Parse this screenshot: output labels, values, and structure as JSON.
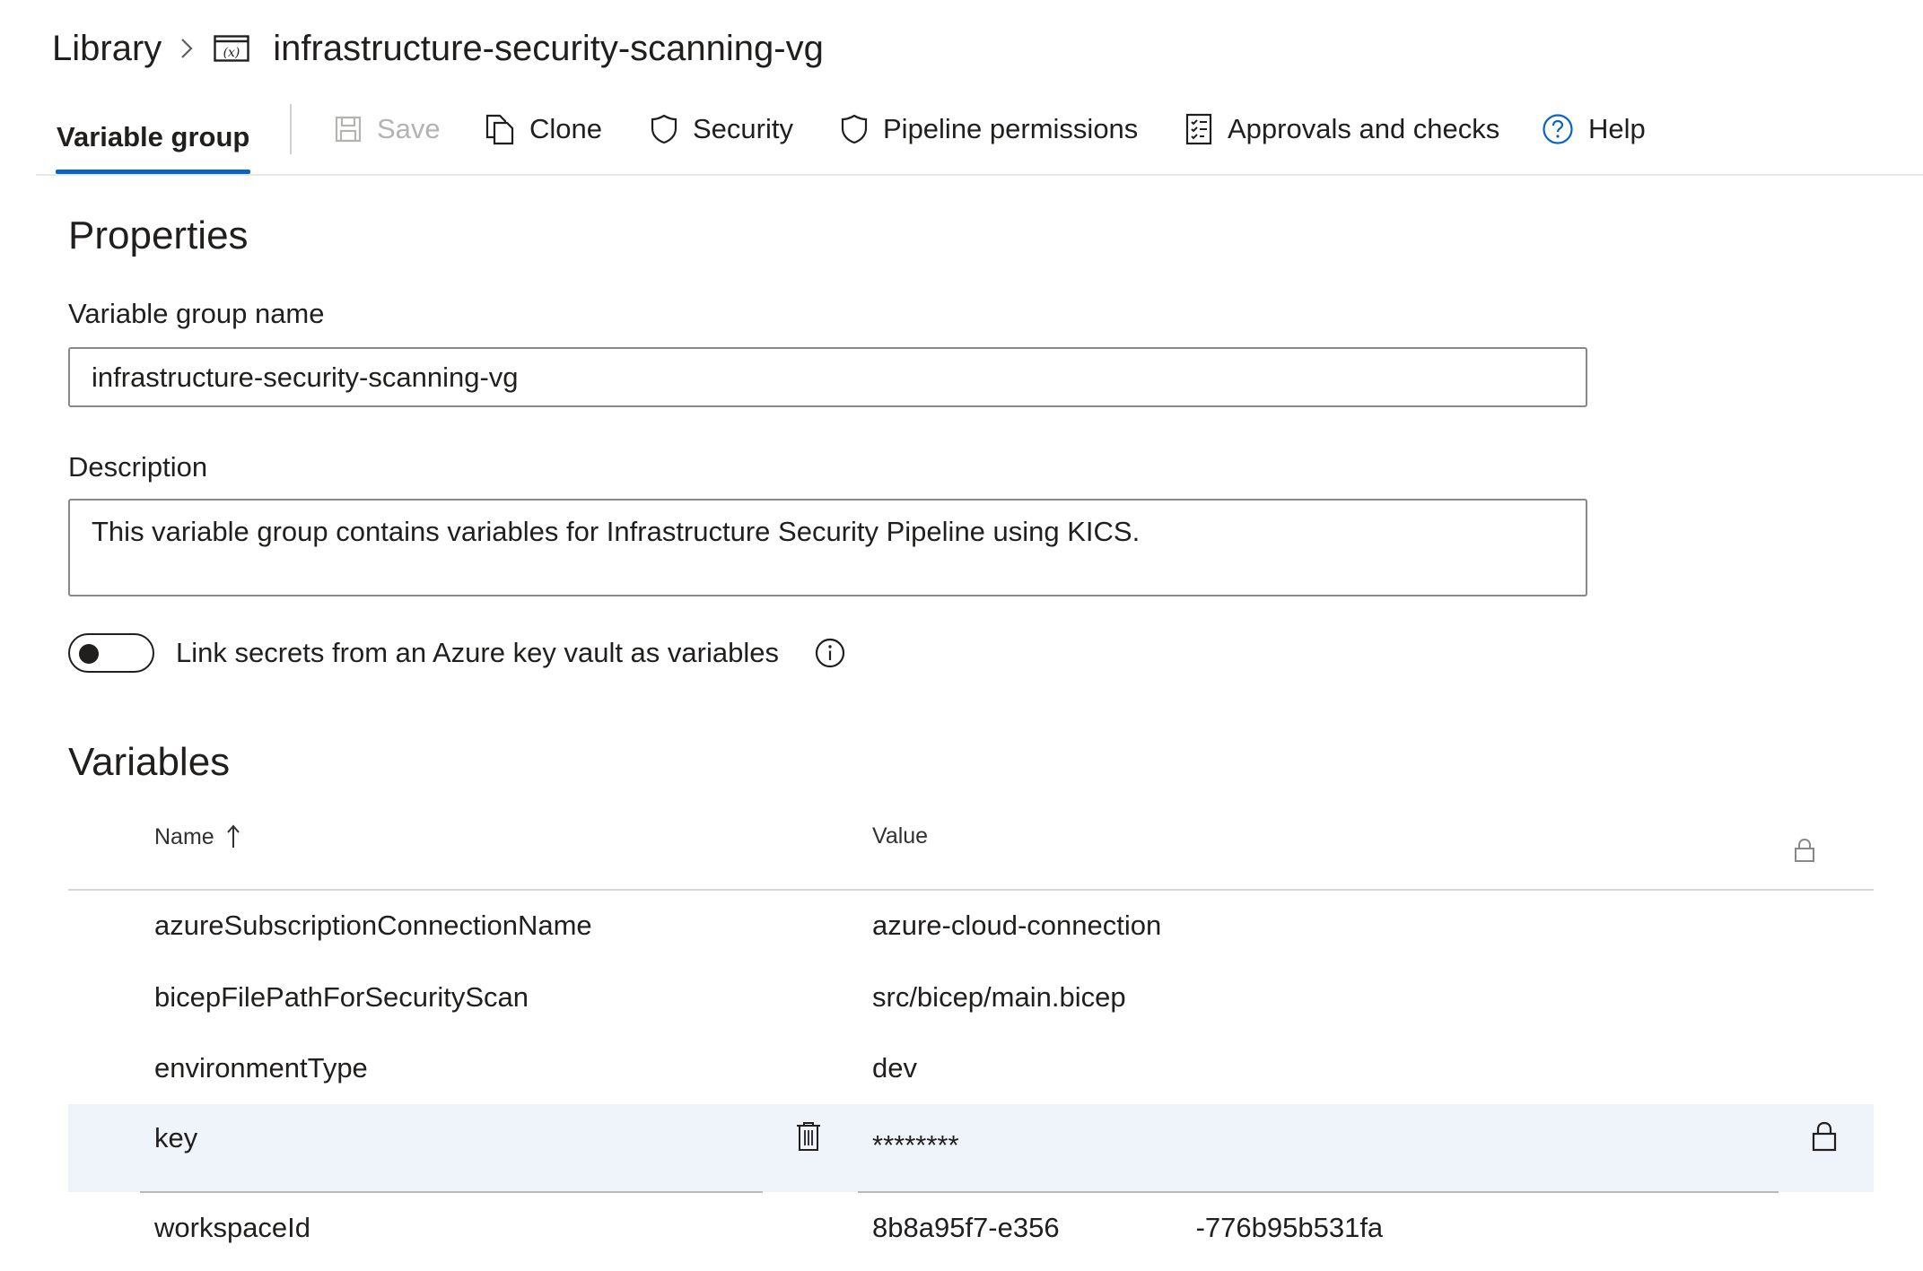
{
  "breadcrumb": {
    "root": "Library",
    "current": "infrastructure-security-scanning-vg",
    "icon": "variable-group-icon"
  },
  "toolbar": {
    "active_tab": "Variable group",
    "save_label": "Save",
    "clone_label": "Clone",
    "security_label": "Security",
    "pipeline_permissions_label": "Pipeline permissions",
    "approvals_label": "Approvals and checks",
    "help_label": "Help"
  },
  "properties": {
    "heading": "Properties",
    "name_label": "Variable group name",
    "name_value": "infrastructure-security-scanning-vg",
    "description_label": "Description",
    "description_value": "This variable group contains variables for Infrastructure Security Pipeline using KICS.",
    "keyvault_toggle_label": "Link secrets from an Azure key vault as variables",
    "keyvault_toggle_on": false
  },
  "variables": {
    "heading": "Variables",
    "columns": {
      "name": "Name",
      "value": "Value"
    },
    "rows": [
      {
        "name": "azureSubscriptionConnectionName",
        "value": "azure-cloud-connection"
      },
      {
        "name": "bicepFilePathForSecurityScan",
        "value": "src/bicep/main.bicep"
      },
      {
        "name": "environmentType",
        "value": "dev"
      },
      {
        "name": "key",
        "value": "********",
        "secret": true,
        "selected": true
      },
      {
        "name": "workspaceId",
        "value_start": "8b8a95f7-e356",
        "value_end": "-776b95b531fa"
      }
    ]
  },
  "colors": {
    "accent": "#0a63c9",
    "selected_row": "#eff4fb",
    "text": "#201f1e"
  }
}
